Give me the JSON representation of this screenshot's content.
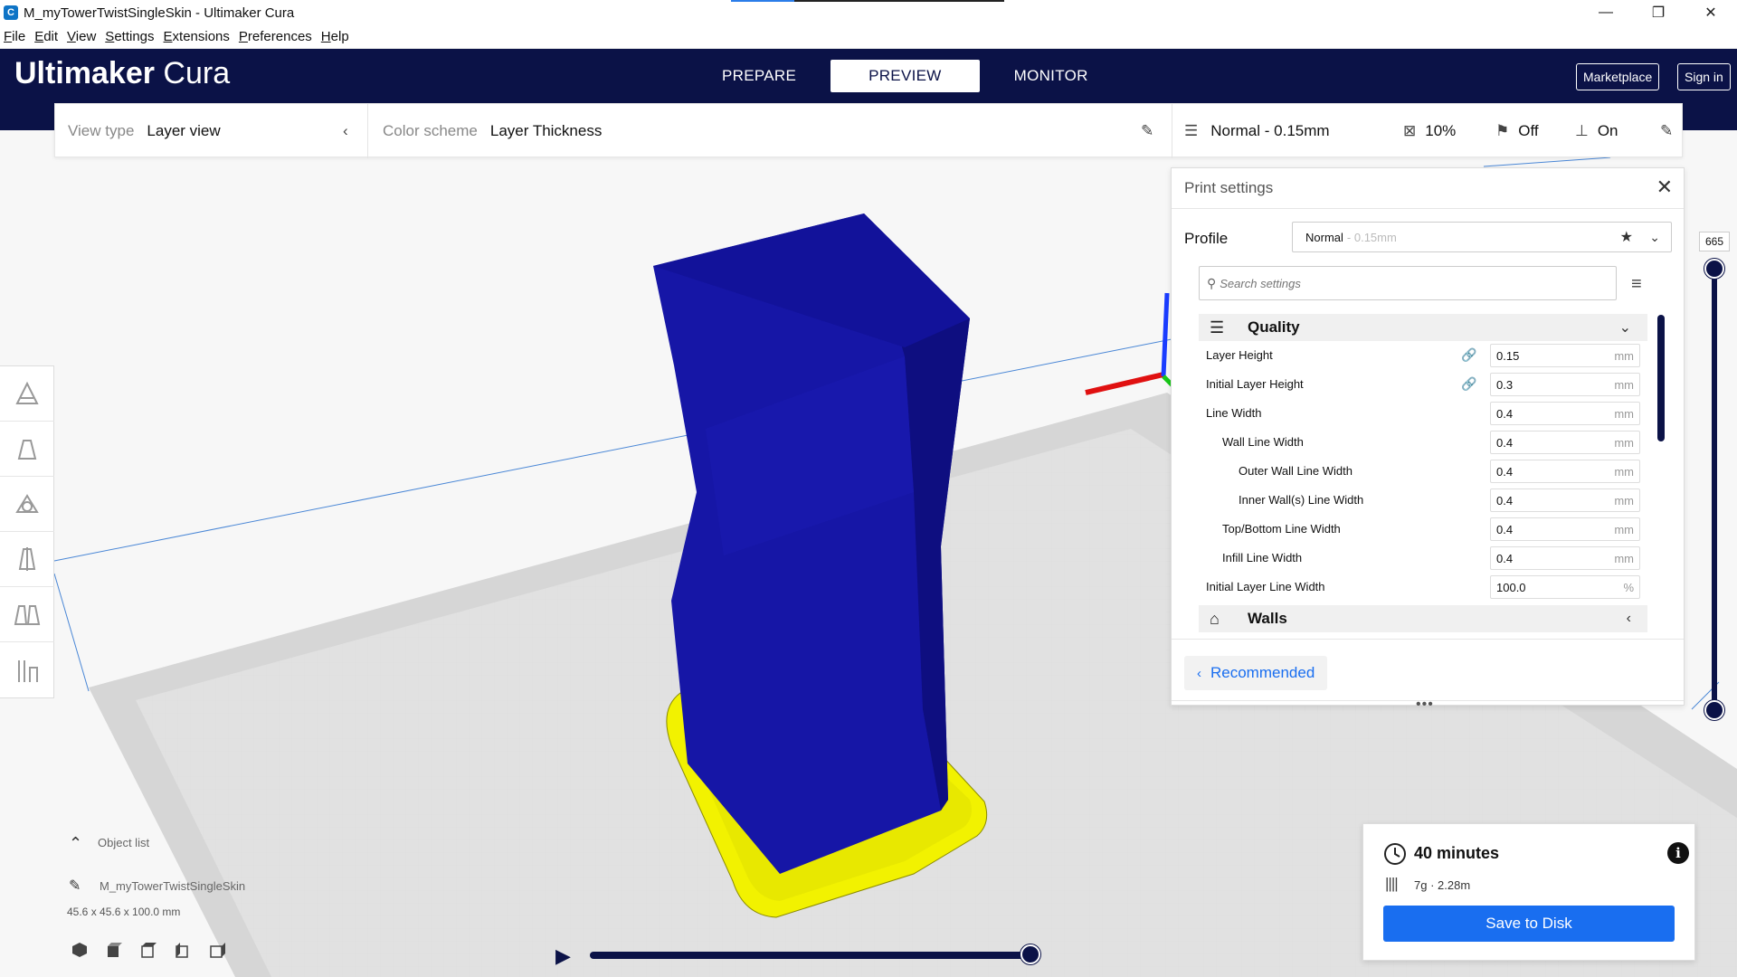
{
  "window": {
    "title": "M_myTowerTwistSingleSkin - Ultimaker Cura",
    "controls": {
      "minimize": "—",
      "restore": "❐",
      "close": "✕"
    }
  },
  "menu": [
    "File",
    "Edit",
    "View",
    "Settings",
    "Extensions",
    "Preferences",
    "Help"
  ],
  "header": {
    "logo_bold": "Ultimaker",
    "logo_light": "Cura",
    "tabs": [
      {
        "label": "PREPARE",
        "active": false
      },
      {
        "label": "PREVIEW",
        "active": true
      },
      {
        "label": "MONITOR",
        "active": false
      }
    ],
    "marketplace": "Marketplace",
    "signin": "Sign in"
  },
  "viewbar": {
    "view_type_label": "View type",
    "view_type_value": "Layer view",
    "color_scheme_label": "Color scheme",
    "color_scheme_value": "Layer Thickness",
    "profile": "Normal - 0.15mm",
    "infill": "10%",
    "support": "Off",
    "adhesion": "On"
  },
  "print_settings": {
    "title": "Print settings",
    "profile_label": "Profile",
    "profile_value": "Normal",
    "profile_suffix": "- 0.15mm",
    "search_placeholder": "Search settings",
    "categories": [
      {
        "label": "Quality",
        "icon": "quality-icon",
        "expanded": true
      },
      {
        "label": "Walls",
        "icon": "walls-icon",
        "expanded": false
      }
    ],
    "settings": [
      {
        "label": "Layer Height",
        "value": "0.15",
        "unit": "mm",
        "indent": 0,
        "linked": true
      },
      {
        "label": "Initial Layer Height",
        "value": "0.3",
        "unit": "mm",
        "indent": 0,
        "linked": true
      },
      {
        "label": "Line Width",
        "value": "0.4",
        "unit": "mm",
        "indent": 0,
        "linked": false
      },
      {
        "label": "Wall Line Width",
        "value": "0.4",
        "unit": "mm",
        "indent": 1,
        "linked": false
      },
      {
        "label": "Outer Wall Line Width",
        "value": "0.4",
        "unit": "mm",
        "indent": 2,
        "linked": false
      },
      {
        "label": "Inner Wall(s) Line Width",
        "value": "0.4",
        "unit": "mm",
        "indent": 2,
        "linked": false
      },
      {
        "label": "Top/Bottom Line Width",
        "value": "0.4",
        "unit": "mm",
        "indent": 1,
        "linked": false
      },
      {
        "label": "Infill Line Width",
        "value": "0.4",
        "unit": "mm",
        "indent": 1,
        "linked": false
      },
      {
        "label": "Initial Layer Line Width",
        "value": "100.0",
        "unit": "%",
        "indent": 0,
        "linked": false
      }
    ],
    "recommended_label": "Recommended"
  },
  "layer_slider": {
    "current": "665"
  },
  "object_list": {
    "title": "Object list",
    "object_name": "M_myTowerTwistSingleSkin",
    "dimensions": "45.6 x 45.6 x 100.0 mm"
  },
  "action_panel": {
    "time": "40 minutes",
    "material": "7g · 2.28m",
    "save_label": "Save to Disk"
  },
  "colors": {
    "header_bg": "#0b1247",
    "accent_blue": "#196ef0",
    "model_blue": "#1717a8",
    "skirt_yellow": "#f2f200"
  }
}
